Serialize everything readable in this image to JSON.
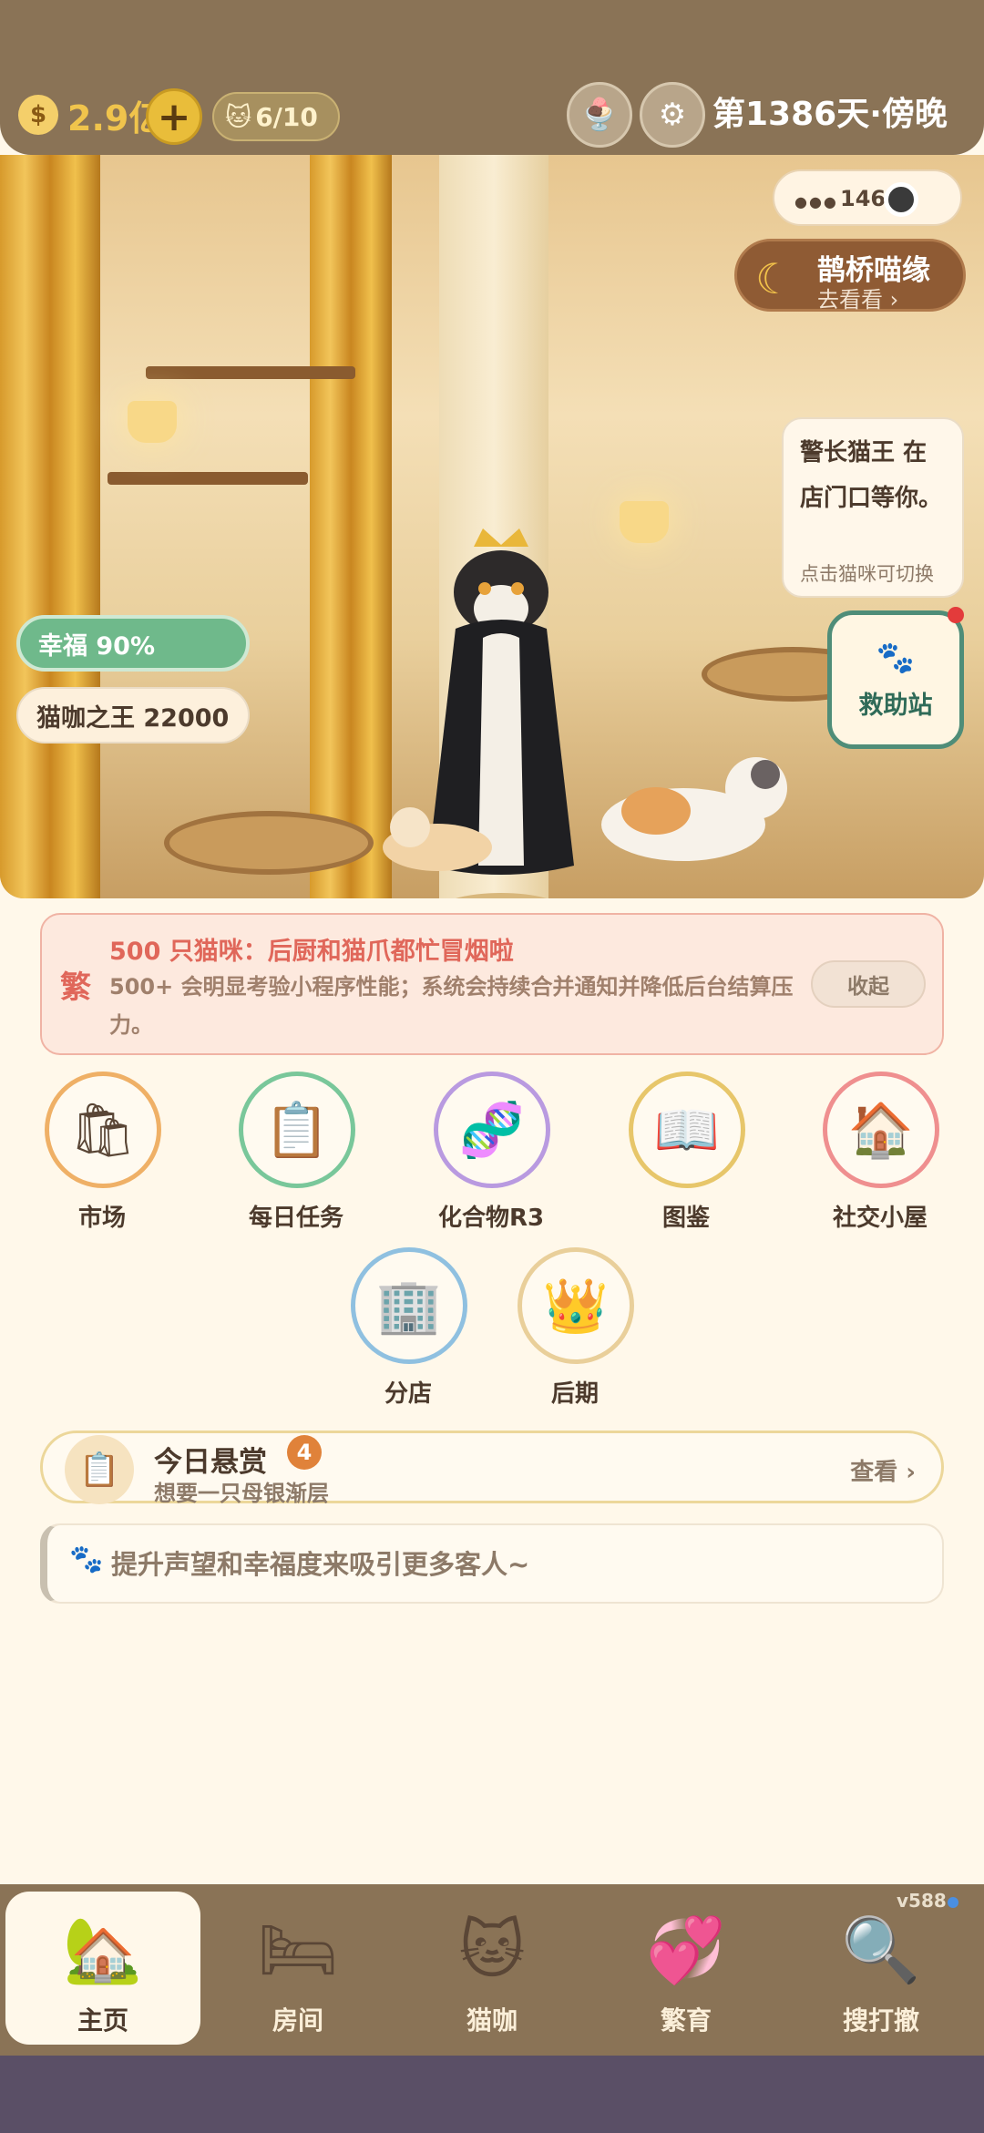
{
  "topbar": {
    "coins": "2.9亿",
    "add_label": "+",
    "cat_count": "6/10",
    "day": "第1386天·傍晚"
  },
  "scene": {
    "online": "146",
    "event": {
      "title": "鹊桥喵缘",
      "sub": "去看看 ›"
    },
    "bubble": {
      "text": "警长猫王 在店门口等你。",
      "hint": "点击猫咪可切换"
    },
    "rescue": "救助站",
    "happiness": "幸福 90%",
    "fame": "猫咖之王 22000"
  },
  "notice": {
    "tag": "繁",
    "title": "500 只猫咪：后厨和猫爪都忙冒烟啦",
    "body": "500+ 会明显考验小程序性能；系统会持续合并通知并降低后台结算压力。",
    "collapse": "收起"
  },
  "features": [
    {
      "label": "市场",
      "icon": "shopping-bag-icon",
      "color": "#efb066"
    },
    {
      "label": "每日任务",
      "icon": "clipboard-icon",
      "color": "#79c79a"
    },
    {
      "label": "化合物R3",
      "icon": "dna-icon",
      "color": "#b99ae0"
    },
    {
      "label": "图鉴",
      "icon": "book-icon",
      "color": "#e7c66a"
    },
    {
      "label": "社交小屋",
      "icon": "house-icon",
      "color": "#ef8f8f"
    },
    {
      "label": "分店",
      "icon": "building-icon",
      "color": "#8fc0e0"
    },
    {
      "label": "后期",
      "icon": "crown-icon",
      "color": "#e9cf9a"
    }
  ],
  "bounty": {
    "title": "今日悬赏",
    "count": "4",
    "sub": "想要一只母银渐层",
    "view": "查看 ›"
  },
  "tip": "提升声望和幸福度来吸引更多客人~",
  "version": "v588",
  "nav": [
    {
      "label": "主页",
      "icon": "home-icon"
    },
    {
      "label": "房间",
      "icon": "room-icon"
    },
    {
      "label": "猫咖",
      "icon": "cat-cup-icon"
    },
    {
      "label": "繁育",
      "icon": "breeding-icon"
    },
    {
      "label": "搜打撤",
      "icon": "magnifier-icon"
    }
  ]
}
